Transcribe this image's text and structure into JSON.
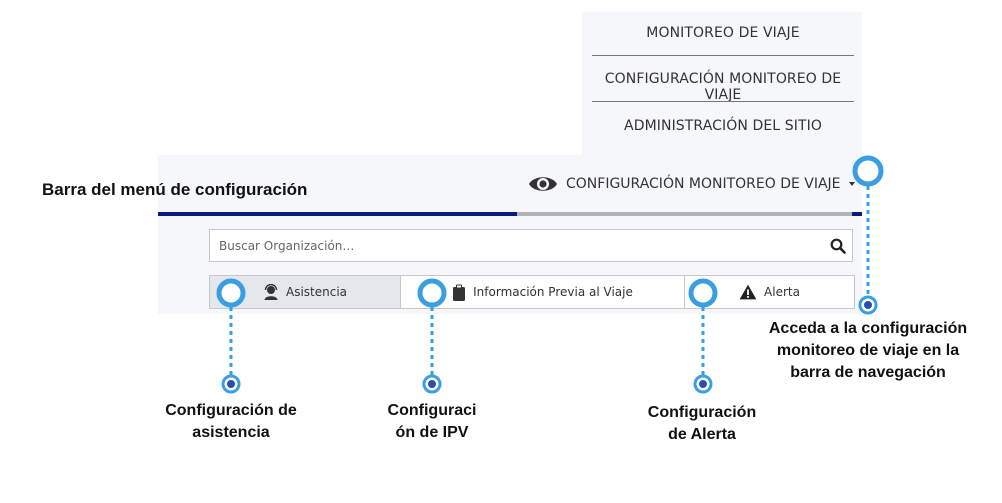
{
  "dropdown": {
    "items": [
      "MONITOREO DE VIAJE",
      "CONFIGURACIÓN MONITOREO DE VIAJE",
      "ADMINISTRACIÓN DEL SITIO"
    ]
  },
  "nav": {
    "selected_label": "CONFIGURACIÓN MONITOREO DE VIAJE",
    "icon": "eye-icon"
  },
  "search": {
    "placeholder": "Buscar Organización…",
    "icon": "search-icon"
  },
  "tabs": [
    {
      "label": "Asistencia",
      "icon": "agent-headset-icon",
      "active": true
    },
    {
      "label": "Información Previa al Viaje",
      "icon": "clipboard-icon",
      "active": false
    },
    {
      "label": "Alerta",
      "icon": "warning-icon",
      "active": false
    }
  ],
  "annotations": {
    "title": "Barra del menú de configuración",
    "callout_asistencia": [
      "Configuración de",
      "asistencia"
    ],
    "callout_ipv": [
      "Configuraci",
      "ón de IPV"
    ],
    "callout_alerta": [
      "Configuración",
      "de Alerta"
    ],
    "callout_nav": [
      "Acceda a la configuración",
      "monitoreo de viaje en la",
      "barra de navegación"
    ]
  },
  "colors": {
    "accent_blue": "#3a9ee2",
    "nav_bar_dark": "#0a1a80",
    "panel_bg": "#f5f7fb"
  }
}
